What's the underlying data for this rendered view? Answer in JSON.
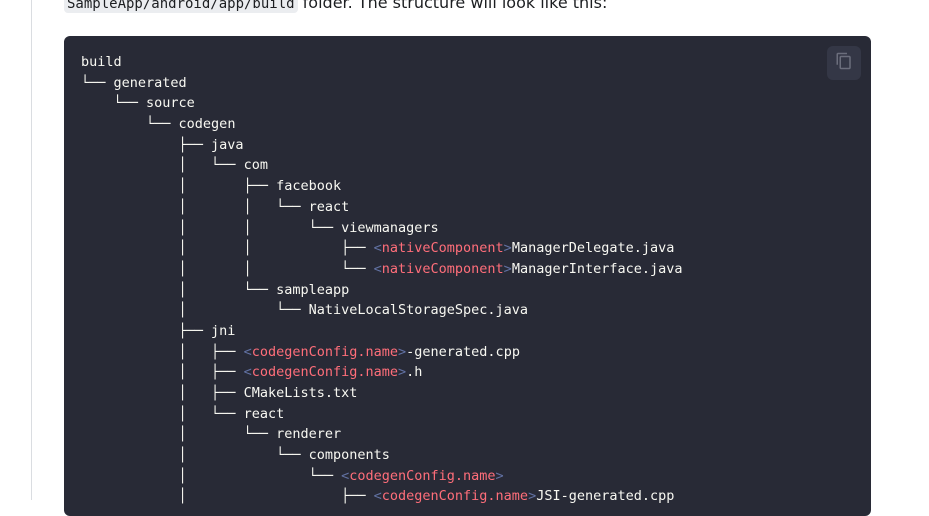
{
  "intro": {
    "path_code": "SampleApp/android/app/build",
    "text": " folder. The structure will look like this:"
  },
  "code_block": {
    "copy_icon": "copy-icon",
    "lines": [
      [
        {
          "t": "build"
        }
      ],
      [
        {
          "tree": "└── "
        },
        {
          "t": "generated"
        }
      ],
      [
        {
          "tree": "    └── "
        },
        {
          "t": "source"
        }
      ],
      [
        {
          "tree": "        └── "
        },
        {
          "t": "codegen"
        }
      ],
      [
        {
          "tree": "            ├── "
        },
        {
          "t": "java"
        }
      ],
      [
        {
          "tree": "            │   └── "
        },
        {
          "t": "com"
        }
      ],
      [
        {
          "tree": "            │       ├── "
        },
        {
          "t": "facebook"
        }
      ],
      [
        {
          "tree": "            │       │   └── "
        },
        {
          "t": "react"
        }
      ],
      [
        {
          "tree": "            │       │       └── "
        },
        {
          "t": "viewmanagers"
        }
      ],
      [
        {
          "tree": "            │       │           ├── "
        },
        {
          "br": "<"
        },
        {
          "tok": "nativeComponent"
        },
        {
          "br": ">"
        },
        {
          "t": "ManagerDelegate.java"
        }
      ],
      [
        {
          "tree": "            │       │           └── "
        },
        {
          "br": "<"
        },
        {
          "tok": "nativeComponent"
        },
        {
          "br": ">"
        },
        {
          "t": "ManagerInterface.java"
        }
      ],
      [
        {
          "tree": "            │       └── "
        },
        {
          "t": "sampleapp"
        }
      ],
      [
        {
          "tree": "            │           └── "
        },
        {
          "t": "NativeLocalStorageSpec.java"
        }
      ],
      [
        {
          "tree": "            ├── "
        },
        {
          "t": "jni"
        }
      ],
      [
        {
          "tree": "            │   ├── "
        },
        {
          "br": "<"
        },
        {
          "tok": "codegenConfig.name"
        },
        {
          "br": ">"
        },
        {
          "t": "-generated.cpp"
        }
      ],
      [
        {
          "tree": "            │   ├── "
        },
        {
          "br": "<"
        },
        {
          "tok": "codegenConfig.name"
        },
        {
          "br": ">"
        },
        {
          "t": ".h"
        }
      ],
      [
        {
          "tree": "            │   ├── "
        },
        {
          "t": "CMakeLists.txt"
        }
      ],
      [
        {
          "tree": "            │   └── "
        },
        {
          "t": "react"
        }
      ],
      [
        {
          "tree": "            │       └── "
        },
        {
          "t": "renderer"
        }
      ],
      [
        {
          "tree": "            │           └── "
        },
        {
          "t": "components"
        }
      ],
      [
        {
          "tree": "            │               └── "
        },
        {
          "br": "<"
        },
        {
          "tok": "codegenConfig.name"
        },
        {
          "br": ">"
        }
      ],
      [
        {
          "tree": "            │                   ├── "
        },
        {
          "br": "<"
        },
        {
          "tok": "codegenConfig.name"
        },
        {
          "br": ">"
        },
        {
          "t": "JSI-generated.cpp"
        }
      ]
    ]
  }
}
